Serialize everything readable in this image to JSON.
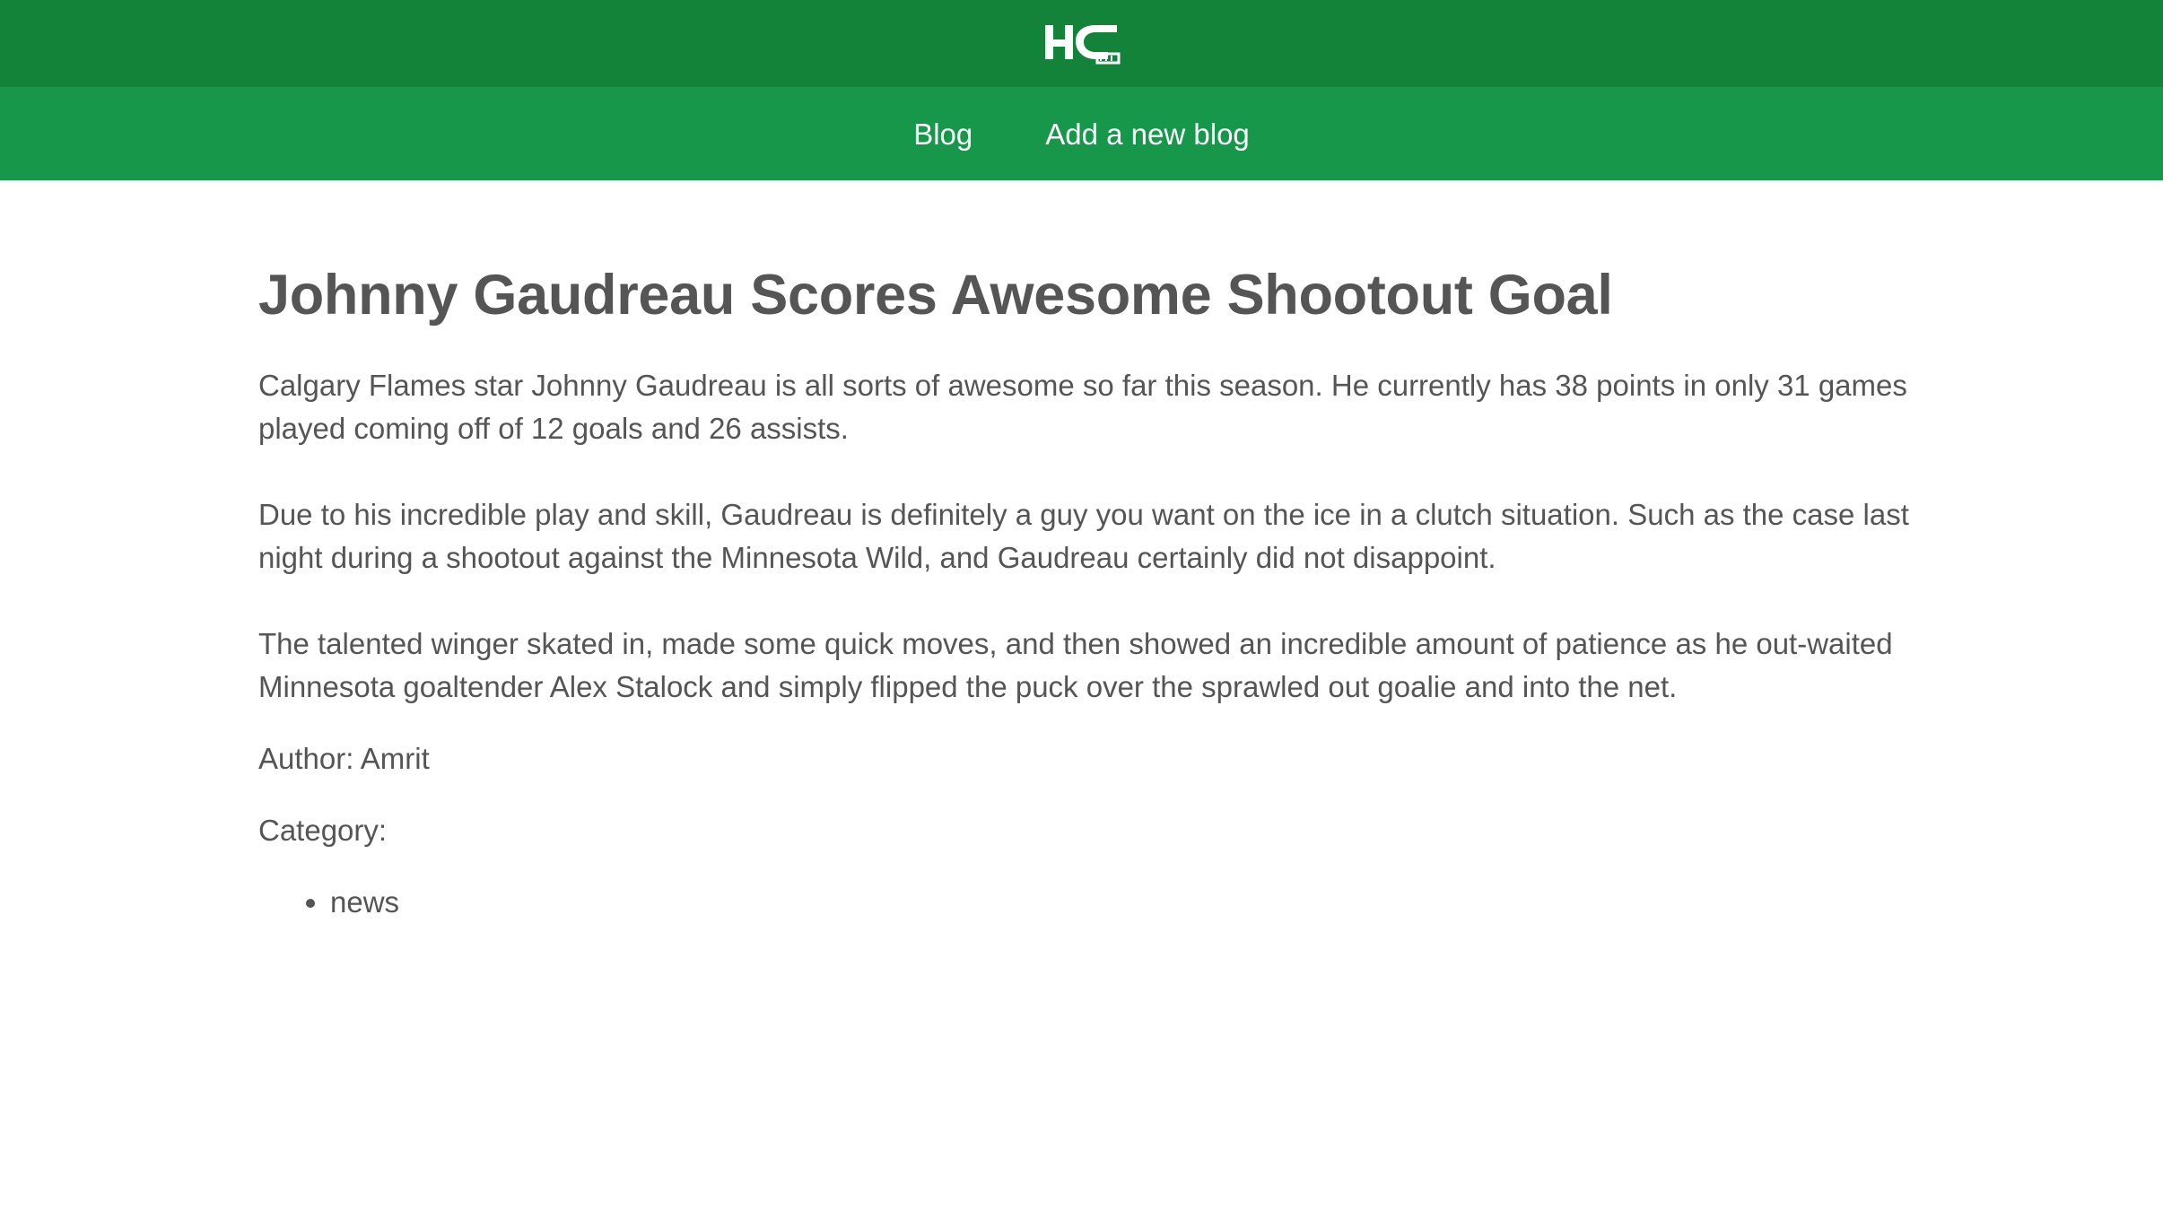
{
  "header": {
    "logo_text": "HC"
  },
  "nav": {
    "items": [
      {
        "label": "Blog"
      },
      {
        "label": "Add a new blog"
      }
    ]
  },
  "post": {
    "title": "Johnny Gaudreau Scores Awesome Shootout Goal",
    "paragraphs": [
      "Calgary Flames star Johnny Gaudreau is all sorts of awesome so far this season. He currently has 38 points in only 31 games played coming off of 12 goals and 26 assists.",
      "Due to his incredible play and skill, Gaudreau is definitely a guy you want on the ice in a clutch situation. Such as the case last night during a shootout against the Minnesota Wild, and Gaudreau certainly did not disappoint.",
      "The talented winger skated in, made some quick moves, and then showed an incredible amount of patience as he out-waited Minnesota goaltender Alex Stalock and simply flipped the puck over the sprawled out goalie and into the net."
    ],
    "author": "Author: Amrit",
    "category_label": "Category:",
    "categories": [
      "news"
    ]
  },
  "colors": {
    "topbar": "#138339",
    "navbar": "#17974a",
    "text": "#555555",
    "nav_text": "#ffffff"
  }
}
